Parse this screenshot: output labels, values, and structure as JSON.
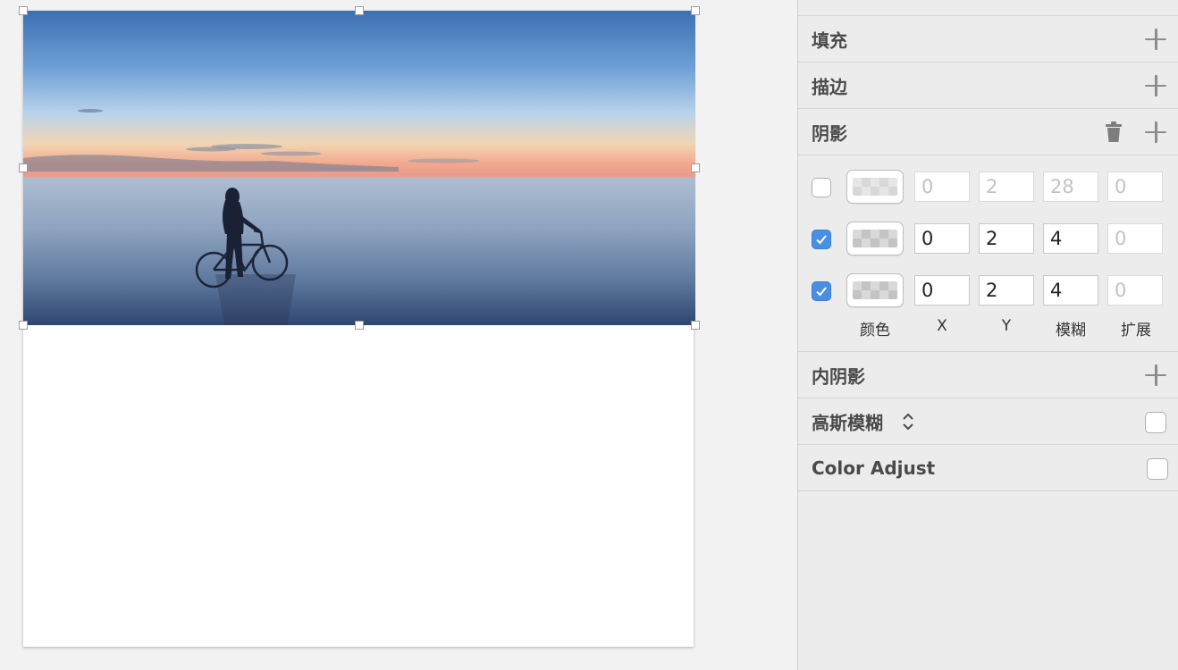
{
  "inspector": {
    "fill": {
      "title": "填充"
    },
    "border": {
      "title": "描边"
    },
    "shadows": {
      "title": "阴影",
      "rows": [
        {
          "enabled": false,
          "x": "0",
          "y": "2",
          "blur": "28",
          "spread": "0"
        },
        {
          "enabled": true,
          "x": "0",
          "y": "2",
          "blur": "4",
          "spread": "0"
        },
        {
          "enabled": true,
          "x": "0",
          "y": "2",
          "blur": "4",
          "spread": "0"
        }
      ],
      "columns": {
        "color": "颜色",
        "x": "X",
        "y": "Y",
        "blur": "模糊",
        "spread": "扩展"
      }
    },
    "inner_shadows": {
      "title": "内阴影"
    },
    "gaussian_blur": {
      "title": "高斯模糊",
      "enabled": false
    },
    "color_adjust": {
      "title": "Color Adjust",
      "enabled": false
    }
  },
  "colors": {
    "accent": "#4a90e2",
    "panel_bg": "#ececec",
    "canvas_bg": "#f2f2f2"
  }
}
